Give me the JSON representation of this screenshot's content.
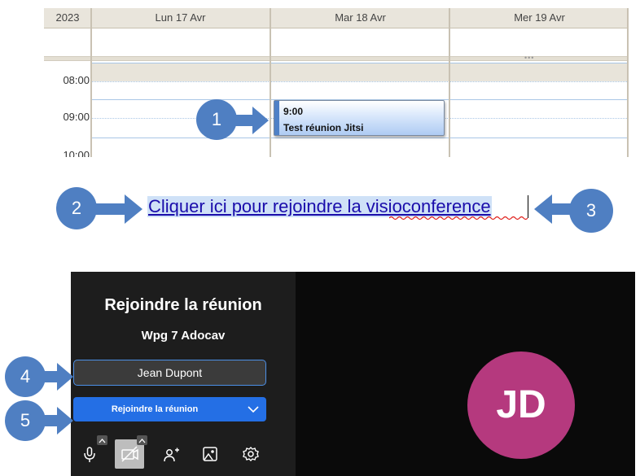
{
  "calendar": {
    "year": "2023",
    "days": [
      "Lun 17 Avr",
      "Mar 18 Avr",
      "Mer 19 Avr"
    ],
    "times": [
      "08:00",
      "09:00",
      "10:00"
    ],
    "event": {
      "time": "9:00",
      "title": "Test réunion Jitsi"
    }
  },
  "callouts": [
    "1",
    "2",
    "3",
    "4",
    "5"
  ],
  "link": {
    "text": "Cliquer ici pour rejoindre la visioconference"
  },
  "jitsi": {
    "title": "Rejoindre la réunion",
    "meeting_name": "Wpg 7 Adocav",
    "name_value": "Jean Dupont",
    "join_label": "Rejoindre la réunion",
    "avatar_initials": "JD",
    "toolbar_icons": [
      "microphone-icon",
      "camera-off-icon",
      "invite-people-icon",
      "background-image-icon",
      "settings-gear-icon"
    ]
  },
  "colors": {
    "callout": "#4f7fc2",
    "join_button": "#246fe5",
    "avatar": "#b5397e",
    "event_bar": "#4f81c7"
  }
}
